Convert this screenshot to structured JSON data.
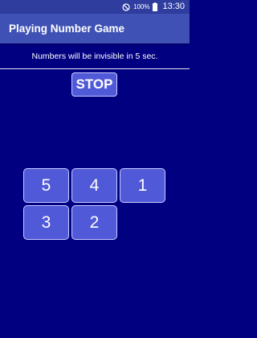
{
  "status_bar": {
    "battery_percent": "100%",
    "time": "13:30",
    "icons": [
      "do-not-disturb-icon",
      "battery-icon"
    ]
  },
  "app_bar": {
    "title": "Playing Number Game"
  },
  "game": {
    "info_text": "Numbers will be invisible in 5 sec.",
    "stop_label": "STOP",
    "tiles": [
      "5",
      "4",
      "1",
      "3",
      "2"
    ]
  },
  "colors": {
    "background": "#000080",
    "status_bar": "#2f3d9f",
    "app_bar": "#3f51b5",
    "tile_fill": "#5059d8",
    "tile_border": "#c8ccff",
    "text": "#ffffff"
  }
}
